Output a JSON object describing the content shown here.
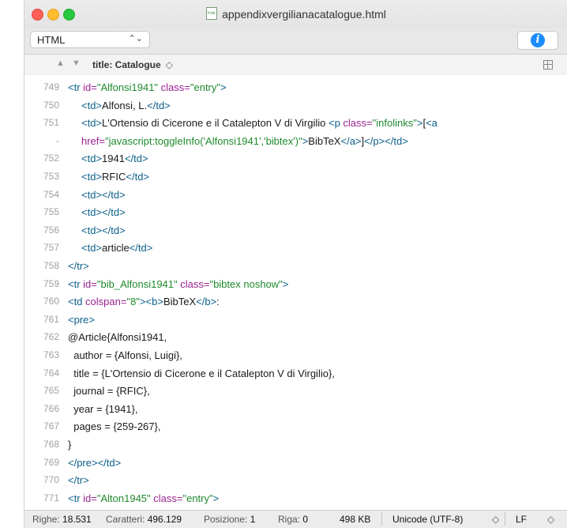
{
  "window": {
    "title": "appendixvergilianacatalogue.html",
    "file_icon_text": "htm"
  },
  "toolbar": {
    "syntax_mode": "HTML",
    "info_label": "i"
  },
  "navbar": {
    "up_icon": "▲",
    "down_icon": "▼",
    "title": "title: Catalogue",
    "chevron": "◇"
  },
  "lines": [
    {
      "num": "749",
      "parts": [
        [
          "t",
          "<tr "
        ],
        [
          "a",
          "id="
        ],
        [
          "s",
          "\"Alfonsi1941\""
        ],
        [
          "a",
          " class="
        ],
        [
          "s",
          "\"entry\""
        ],
        [
          "t",
          ">"
        ]
      ],
      "indent": 0
    },
    {
      "num": "750",
      "parts": [
        [
          "t",
          "<td>"
        ],
        [
          "p",
          "Alfonsi, L."
        ],
        [
          "t",
          "</td>"
        ]
      ],
      "indent": 1
    },
    {
      "num": "751",
      "parts": [
        [
          "t",
          "<td>"
        ],
        [
          "p",
          "L'Ortensio di Cicerone e il Catalepton V di Virgilio "
        ],
        [
          "t",
          "<p "
        ],
        [
          "a",
          "class="
        ],
        [
          "s",
          "\"infolinks\""
        ],
        [
          "t",
          ">"
        ],
        [
          "p",
          "["
        ],
        [
          "t",
          "<a"
        ]
      ],
      "indent": 1
    },
    {
      "num": "-",
      "parts": [
        [
          "a",
          "href="
        ],
        [
          "s",
          "\"javascript:toggleInfo('Alfonsi1941','bibtex')\""
        ],
        [
          "t",
          ">"
        ],
        [
          "p",
          "BibTeX"
        ],
        [
          "t",
          "</a>"
        ],
        [
          "p",
          "]"
        ],
        [
          "t",
          "</p></td>"
        ]
      ],
      "indent": 1
    },
    {
      "num": "752",
      "parts": [
        [
          "t",
          "<td>"
        ],
        [
          "p",
          "1941"
        ],
        [
          "t",
          "</td>"
        ]
      ],
      "indent": 1
    },
    {
      "num": "753",
      "parts": [
        [
          "t",
          "<td>"
        ],
        [
          "p",
          "RFIC"
        ],
        [
          "t",
          "</td>"
        ]
      ],
      "indent": 1
    },
    {
      "num": "754",
      "parts": [
        [
          "t",
          "<td></td>"
        ]
      ],
      "indent": 1
    },
    {
      "num": "755",
      "parts": [
        [
          "t",
          "<td></td>"
        ]
      ],
      "indent": 1
    },
    {
      "num": "756",
      "parts": [
        [
          "t",
          "<td></td>"
        ]
      ],
      "indent": 1
    },
    {
      "num": "757",
      "parts": [
        [
          "t",
          "<td>"
        ],
        [
          "p",
          "article"
        ],
        [
          "t",
          "</td>"
        ]
      ],
      "indent": 1
    },
    {
      "num": "758",
      "parts": [
        [
          "t",
          "</tr>"
        ]
      ],
      "indent": 0
    },
    {
      "num": "759",
      "parts": [
        [
          "t",
          "<tr "
        ],
        [
          "a",
          "id="
        ],
        [
          "s",
          "\"bib_Alfonsi1941\""
        ],
        [
          "a",
          " class="
        ],
        [
          "s",
          "\"bibtex noshow\""
        ],
        [
          "t",
          ">"
        ]
      ],
      "indent": 0
    },
    {
      "num": "760",
      "parts": [
        [
          "t",
          "<td "
        ],
        [
          "a",
          "colspan="
        ],
        [
          "s",
          "\"8\""
        ],
        [
          "t",
          "><b>"
        ],
        [
          "p",
          "BibTeX"
        ],
        [
          "t",
          "</b>"
        ],
        [
          "p",
          ":"
        ]
      ],
      "indent": 0
    },
    {
      "num": "761",
      "parts": [
        [
          "t",
          "<pre>"
        ]
      ],
      "indent": 0
    },
    {
      "num": "762",
      "parts": [
        [
          "p",
          "@Article{Alfonsi1941,"
        ]
      ],
      "indent": 0
    },
    {
      "num": "763",
      "parts": [
        [
          "p",
          "  author = {Alfonsi, Luigi},"
        ]
      ],
      "indent": 0
    },
    {
      "num": "764",
      "parts": [
        [
          "p",
          "  title = {L'Ortensio di Cicerone e il Catalepton V di Virgilio},"
        ]
      ],
      "indent": 0
    },
    {
      "num": "765",
      "parts": [
        [
          "p",
          "  journal = {RFIC},"
        ]
      ],
      "indent": 0
    },
    {
      "num": "766",
      "parts": [
        [
          "p",
          "  year = {1941},"
        ]
      ],
      "indent": 0
    },
    {
      "num": "767",
      "parts": [
        [
          "p",
          "  pages = {259-267},"
        ]
      ],
      "indent": 0
    },
    {
      "num": "768",
      "parts": [
        [
          "p",
          "}"
        ]
      ],
      "indent": 0
    },
    {
      "num": "769",
      "parts": [
        [
          "t",
          "</pre></td>"
        ]
      ],
      "indent": 0
    },
    {
      "num": "770",
      "parts": [
        [
          "t",
          "</tr>"
        ]
      ],
      "indent": 0
    },
    {
      "num": "771",
      "parts": [
        [
          "t",
          "<tr "
        ],
        [
          "a",
          "id="
        ],
        [
          "s",
          "\"Alton1945\""
        ],
        [
          "a",
          " class="
        ],
        [
          "s",
          "\"entry\""
        ],
        [
          "t",
          ">"
        ]
      ],
      "indent": 0
    }
  ],
  "status": {
    "righe_label": "Righe:",
    "righe": "18.531",
    "caratteri_label": "Caratteri:",
    "caratteri": "496.129",
    "posizione_label": "Posizione:",
    "posizione": "1",
    "riga_label": "Riga:",
    "riga": "0",
    "size": "498 KB",
    "encoding": "Unicode (UTF-8)",
    "line_ending": "LF",
    "chevron": "◇"
  }
}
